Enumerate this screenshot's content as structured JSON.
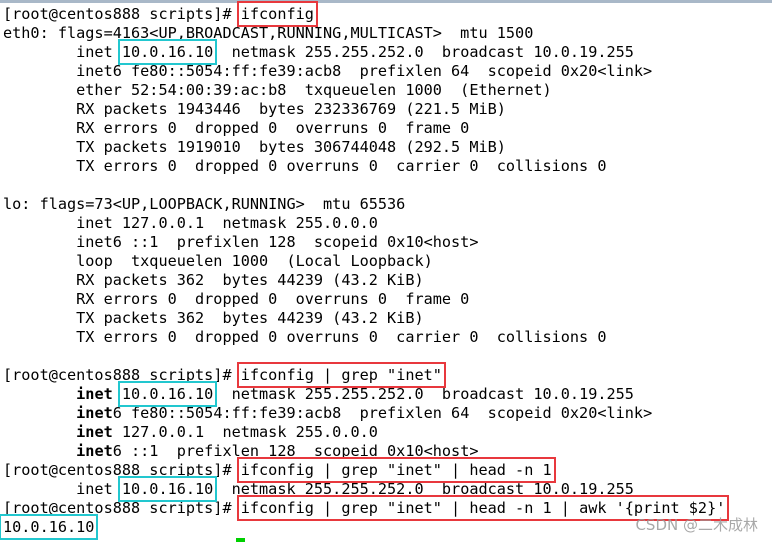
{
  "colors": {
    "command_box": "#e8383d",
    "ip_box": "#22c7cf",
    "cursor": "#00d000"
  },
  "lines": [
    [
      {
        "t": "[root@centos888 scripts]# "
      },
      {
        "t": "ifconfig",
        "c": "red"
      }
    ],
    [
      {
        "t": "eth0: flags=4163<UP,BROADCAST,RUNNING,MULTICAST>  mtu 1500"
      }
    ],
    [
      {
        "t": "        inet "
      },
      {
        "t": "10.0.16.10",
        "c": "cyan"
      },
      {
        "t": "  netmask 255.255.252.0  broadcast 10.0.19.255"
      }
    ],
    [
      {
        "t": "        inet6 fe80::5054:ff:fe39:acb8  prefixlen 64  scopeid 0x20<link>"
      }
    ],
    [
      {
        "t": "        ether 52:54:00:39:ac:b8  txqueuelen 1000  (Ethernet)"
      }
    ],
    [
      {
        "t": "        RX packets 1943446  bytes 232336769 (221.5 MiB)"
      }
    ],
    [
      {
        "t": "        RX errors 0  dropped 0  overruns 0  frame 0"
      }
    ],
    [
      {
        "t": "        TX packets 1919010  bytes 306744048 (292.5 MiB)"
      }
    ],
    [
      {
        "t": "        TX errors 0  dropped 0 overruns 0  carrier 0  collisions 0"
      }
    ],
    [
      {
        "t": ""
      }
    ],
    [
      {
        "t": "lo: flags=73<UP,LOOPBACK,RUNNING>  mtu 65536"
      }
    ],
    [
      {
        "t": "        inet 127.0.0.1  netmask 255.0.0.0"
      }
    ],
    [
      {
        "t": "        inet6 ::1  prefixlen 128  scopeid 0x10<host>"
      }
    ],
    [
      {
        "t": "        loop  txqueuelen 1000  (Local Loopback)"
      }
    ],
    [
      {
        "t": "        RX packets 362  bytes 44239 (43.2 KiB)"
      }
    ],
    [
      {
        "t": "        RX errors 0  dropped 0  overruns 0  frame 0"
      }
    ],
    [
      {
        "t": "        TX packets 362  bytes 44239 (43.2 KiB)"
      }
    ],
    [
      {
        "t": "        TX errors 0  dropped 0 overruns 0  carrier 0  collisions 0"
      }
    ],
    [
      {
        "t": ""
      }
    ],
    [
      {
        "t": "[root@centos888 scripts]# "
      },
      {
        "t": "ifconfig | grep \"inet\"",
        "c": "red"
      }
    ],
    [
      {
        "t": "        "
      },
      {
        "t": "inet",
        "c": "b"
      },
      {
        "t": " "
      },
      {
        "t": "10.0.16.10",
        "c": "cyan"
      },
      {
        "t": "  netmask 255.255.252.0  broadcast 10.0.19.255"
      }
    ],
    [
      {
        "t": "        "
      },
      {
        "t": "inet",
        "c": "b"
      },
      {
        "t": "6 fe80::5054:ff:fe39:acb8  prefixlen 64  scopeid 0x20<link>"
      }
    ],
    [
      {
        "t": "        "
      },
      {
        "t": "inet",
        "c": "b"
      },
      {
        "t": " 127.0.0.1  netmask 255.0.0.0"
      }
    ],
    [
      {
        "t": "        "
      },
      {
        "t": "inet",
        "c": "b"
      },
      {
        "t": "6 ::1  prefixlen 128  scopeid 0x10<host>"
      }
    ],
    [
      {
        "t": "[root@centos888 scripts]# "
      },
      {
        "t": "ifconfig | grep \"inet\" | head -n 1",
        "c": "red"
      }
    ],
    [
      {
        "t": "        inet "
      },
      {
        "t": "10.0.16.10",
        "c": "cyan"
      },
      {
        "t": "  netmask 255.255.252.0  broadcast 10.0.19.255"
      }
    ],
    [
      {
        "t": "[root@centos888 scripts]# "
      },
      {
        "t": "ifconfig | grep \"inet\" | head -n 1 | awk '{print $2}'",
        "c": "red"
      }
    ],
    [
      {
        "t": "10.0.16.10",
        "c": "cyan"
      }
    ]
  ],
  "watermark": "CSDN @二木成林"
}
